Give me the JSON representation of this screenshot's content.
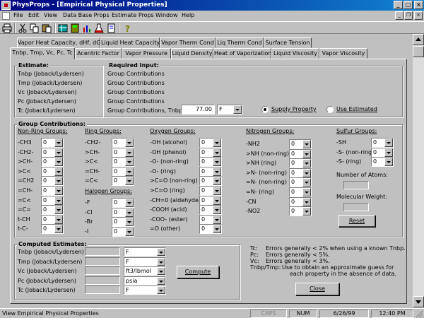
{
  "window": {
    "title": "PhysProps - [Empirical Physical Properties]"
  },
  "menu": [
    "File",
    "Edit",
    "View",
    "Data Base Props",
    "Estimate Props",
    "Window",
    "Help"
  ],
  "toolbar": {
    "icons": [
      "printer-icon",
      "cut-icon",
      "copy-icon",
      "paste-icon",
      "grid-icon",
      "calculator-icon",
      "chart-icon",
      "flask-icon",
      "document-icon",
      "help-icon"
    ]
  },
  "tabs_row1": [
    "Vapor Heat Capacity, dHf, dGf",
    "Liquid Heat Capacity",
    "Vapor Therm Cond",
    "Liq Therm Cond",
    "Surface Tension"
  ],
  "tabs_row2": [
    "Tnbp, Tmp, Vc, Pc, Tc",
    "Acentric Factor",
    "Vapor Pressure",
    "Liquid Density",
    "Heat of Vaporization",
    "Liquid Viscosity",
    "Vapor Viscosity"
  ],
  "estimate": {
    "title": "Estimate:",
    "items": [
      "Tnbp (Joback/Lydersen)",
      "Tmp (Joback/Lydersen)",
      "Vc (Joback/Lydersen)",
      "Pc (Joback/Lydersen)",
      "Tc (Joback/Lydersen)"
    ]
  },
  "required": {
    "title": "Required Input:",
    "items": [
      "Group Contributions",
      "Group Contributions",
      "Group Contributions",
      "Group Contributions",
      "Group Contributions, Tnbp:"
    ],
    "tnbp_value": "77.00",
    "tnbp_unit": "F",
    "radio_supply": "Supply Property",
    "radio_estimate": "Use Estimated"
  },
  "groups": {
    "title": "Group Contributions:",
    "non_ring": {
      "title": "Non-Ring Groups:",
      "labels": [
        "-CH3",
        "-CH2-",
        ">CH-",
        ">C<",
        "=CH2",
        "=CH-",
        "=C<",
        "=C=",
        "t-CH",
        "t-C-"
      ]
    },
    "ring": {
      "title": "Ring Groups:",
      "labels": [
        "-CH2-",
        ">CH-",
        ">C<",
        "=CH-",
        "=C<"
      ]
    },
    "halogen": {
      "title": "Halogen Groups:",
      "labels": [
        "-F",
        "-Cl",
        "-Br",
        "-I"
      ]
    },
    "oxygen": {
      "title": "Oxygen Groups:",
      "labels": [
        "-OH (alcohol)",
        "-OH (phenol)",
        "-O- (non-ring)",
        "-O- (ring)",
        ">C=O (non-ring)",
        ">C=O (ring)",
        "-CH=0 (aldehyde)",
        "-COOH (acid)",
        "-COO- (ester)",
        "=O (other)"
      ]
    },
    "nitrogen": {
      "title": "Nitrogen Groups:",
      "labels": [
        "-NH2",
        ">NH (non-ring)",
        ">NH (ring)",
        ">N- (non-ring)",
        "=N- (non-ring)",
        "=N- (ring)",
        "-CN",
        "-NO2"
      ]
    },
    "sulfur": {
      "title": "Sulfur Groups:",
      "labels": [
        "-SH",
        "-S- (non-ring)",
        "-S- (ring)"
      ]
    },
    "default_value": "0",
    "atoms_label": "Number of Atoms:",
    "mw_label": "Molecular Weight:",
    "reset": "Reset"
  },
  "computed": {
    "title": "Computed Estimates:",
    "labels": [
      "Tnbp (Joback/Lydersen)",
      "Tmp (Joback/Lydersen)",
      "Vc (Joback/Lydersen)",
      "Pc (Joback/Lydersen)",
      "Tc (Joback/Lydersen)"
    ],
    "units": [
      "F",
      "F",
      "ft3/lbmol",
      "psia",
      "F"
    ],
    "compute": "Compute"
  },
  "notes": [
    [
      "Tc:",
      "Errors generally < 2% when using a known Tnbp."
    ],
    [
      "Pc:",
      "Errors generally < 5%."
    ],
    [
      "Vc:",
      "Errors generally < 3%."
    ],
    [
      "Tnbp/Tmp:",
      "Use to obtain an approximate guess for"
    ],
    [
      "",
      "each property in the absence of data."
    ]
  ],
  "close": "Close",
  "status": {
    "text": "View Empirical Physical Properties",
    "caps": "CAPS",
    "num": "NUM",
    "date": "6/26/99",
    "time": "12:40 PM"
  }
}
